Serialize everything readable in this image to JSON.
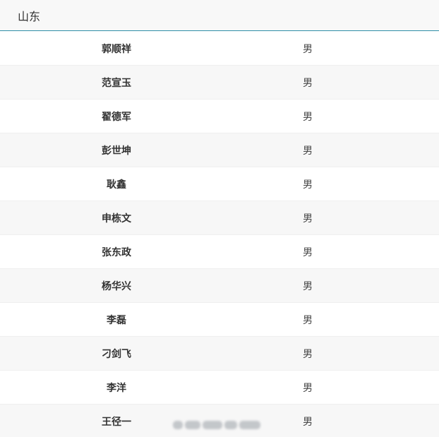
{
  "section": {
    "title": "山东"
  },
  "rows": [
    {
      "name": "郭顺祥",
      "gender": "男"
    },
    {
      "name": "范宣玉",
      "gender": "男"
    },
    {
      "name": "翟德军",
      "gender": "男"
    },
    {
      "name": "彭世坤",
      "gender": "男"
    },
    {
      "name": "耿鑫",
      "gender": "男"
    },
    {
      "name": "申栋文",
      "gender": "男"
    },
    {
      "name": "张东政",
      "gender": "男"
    },
    {
      "name": "杨华兴",
      "gender": "男"
    },
    {
      "name": "李磊",
      "gender": "男"
    },
    {
      "name": "刁剑飞",
      "gender": "男"
    },
    {
      "name": "李洋",
      "gender": "男"
    },
    {
      "name": "王径一",
      "gender": "男"
    }
  ],
  "colors": {
    "header_background": "#f8f8f8",
    "header_border": "#2f8fa8",
    "row_alt_background": "#f7f7f7"
  }
}
